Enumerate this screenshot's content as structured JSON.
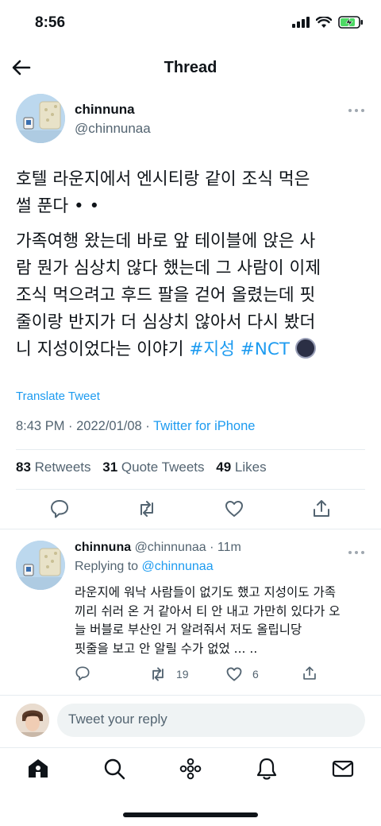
{
  "status_bar": {
    "time": "8:56"
  },
  "header": {
    "title": "Thread"
  },
  "tweet": {
    "author_name": "chinnuna",
    "author_handle": "@chinnunaa",
    "title_line_1": "호텔 라운지에서 엔시티랑 같이 조식 먹은",
    "title_line_2": "썰 푼다 • •",
    "body_lines": [
      "가족여행 왔는데 바로 앞 테이블에 앉은 사",
      "람 뭔가 심상치 않다 했는데 그 사람이 이제",
      "조식 먹으려고 후드 팔을 걷어 올렸는데 핏",
      "줄이랑 반지가 더 심상치 않아서 다시 봤더"
    ],
    "last_line_text": "니 지성이었다는 이야기",
    "hashtag_1": "#지성",
    "hashtag_2": "#NCT",
    "translate_label": "Translate Tweet",
    "timestamp": "8:43 PM · 2022/01/08 · ",
    "source": "Twitter for iPhone",
    "retweets_count": "83",
    "retweets_label": "Retweets",
    "quotes_count": "31",
    "quotes_label": "Quote Tweets",
    "likes_count": "49",
    "likes_label": "Likes"
  },
  "reply": {
    "author_name": "chinnuna",
    "author_handle": "@chinnunaa",
    "time": "· 11m",
    "replying_prefix": "Replying to",
    "replying_handle": "@chinnunaa",
    "text_lines": [
      "라운지에 워낙 사람들이 없기도 했고 지성이도 가족",
      "끼리 쉬러 온 거 같아서 티 안 내고 가만히 있다가 오",
      "늘 버블로 부산인 거 알려줘서 저도 올립니당",
      "핏줄을 보고 안 알릴 수가 없었 ... .."
    ],
    "retweet_count": "19",
    "like_count": "6"
  },
  "compose": {
    "placeholder": "Tweet your reply"
  },
  "colors": {
    "accent": "#1d9bf0",
    "text": "#0f1419",
    "muted": "#536471",
    "divider": "#e6ecf0"
  },
  "icons": [
    "back-arrow-icon",
    "more-icon",
    "reply-icon",
    "retweet-icon",
    "like-icon",
    "share-icon",
    "home-icon",
    "search-icon",
    "spaces-icon",
    "notifications-icon",
    "messages-icon"
  ]
}
